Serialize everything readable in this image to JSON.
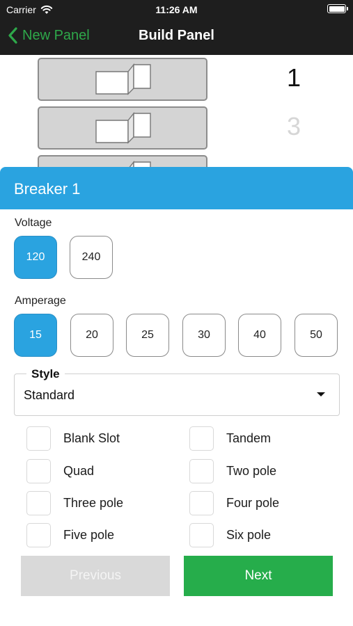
{
  "status_bar": {
    "carrier": "Carrier",
    "time": "11:26 AM"
  },
  "nav": {
    "back_label": "New Panel",
    "title": "Build Panel"
  },
  "panel_preview": {
    "slot_numbers": [
      "1",
      "3"
    ]
  },
  "sheet": {
    "title": "Breaker 1",
    "voltage": {
      "label": "Voltage",
      "options": [
        "120",
        "240"
      ],
      "selected": "120"
    },
    "amperage": {
      "label": "Amperage",
      "options": [
        "15",
        "20",
        "25",
        "30",
        "40",
        "50"
      ],
      "selected": "15"
    },
    "style": {
      "legend": "Style",
      "value": "Standard"
    },
    "checkboxes": [
      "Blank Slot",
      "Tandem",
      "Quad",
      "Two pole",
      "Three pole",
      "Four pole",
      "Five pole",
      "Six pole"
    ],
    "buttons": {
      "previous": "Previous",
      "next": "Next"
    }
  },
  "colors": {
    "accent": "#2aa3e0",
    "primary_button": "#26ad4b",
    "back_link": "#2ea84a",
    "nav_bg": "#1e1e1e"
  }
}
